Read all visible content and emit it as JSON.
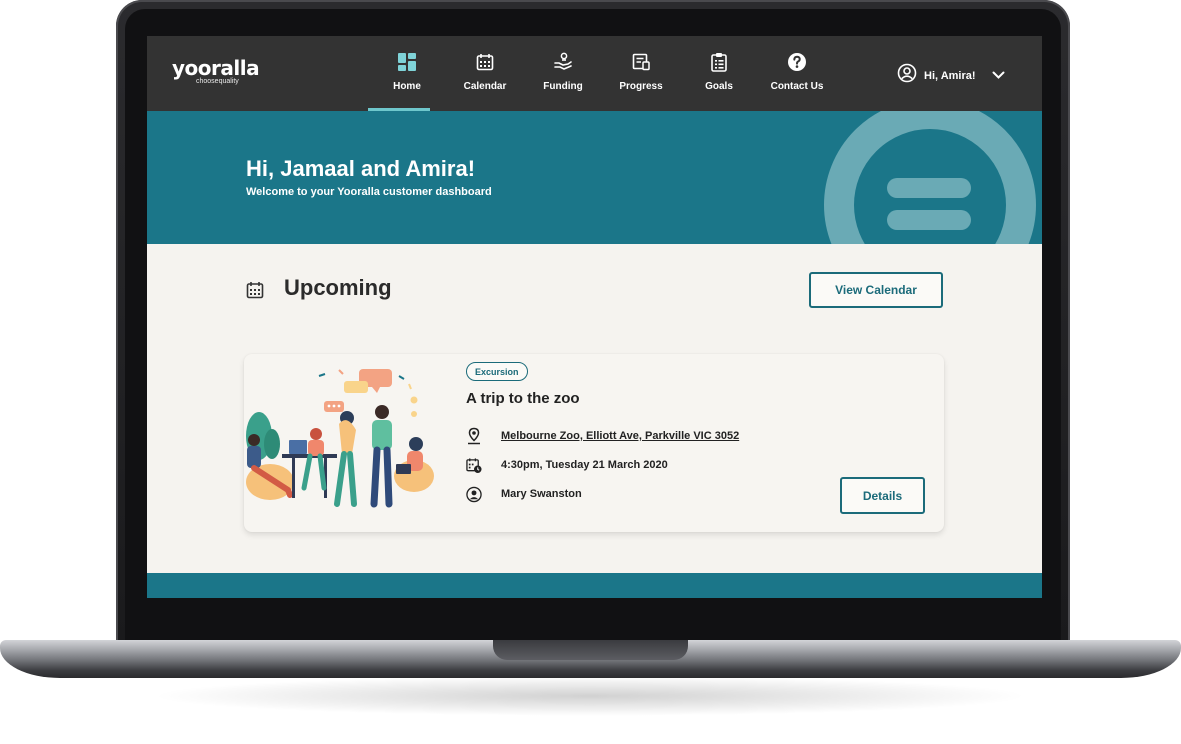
{
  "nav": {
    "logo_main": "yooralla",
    "logo_tagline": "choosequality",
    "items": [
      {
        "label": "Home",
        "icon": "dashboard-grid-icon",
        "active": true
      },
      {
        "label": "Calendar",
        "icon": "calendar-icon",
        "active": false
      },
      {
        "label": "Funding",
        "icon": "funding-hand-icon",
        "active": false
      },
      {
        "label": "Progress",
        "icon": "progress-report-icon",
        "active": false
      },
      {
        "label": "Goals",
        "icon": "goals-clipboard-icon",
        "active": false
      },
      {
        "label": "Contact Us",
        "icon": "question-mark-icon",
        "active": false
      }
    ],
    "user_greeting": "Hi, Amira!"
  },
  "hero": {
    "title": "Hi, Jamaal and Amira!",
    "subtitle": "Welcome to your Yooralla customer dashboard"
  },
  "upcoming": {
    "title": "Upcoming",
    "view_calendar_label": "View Calendar",
    "event": {
      "badge": "Excursion",
      "title": "A trip to the zoo",
      "location": "Melbourne Zoo, Elliott Ave, Parkville VIC 3052",
      "datetime": "4:30pm, Tuesday 21 March 2020",
      "host": "Mary Swanston",
      "details_label": "Details"
    }
  },
  "colors": {
    "nav_bg": "#333333",
    "brand_teal": "#1b7689",
    "accent_light_teal": "#6aaab5",
    "active_underline": "#6ec7cc",
    "page_bg": "#f5f3ef",
    "button_text": "#1b6b7a"
  }
}
